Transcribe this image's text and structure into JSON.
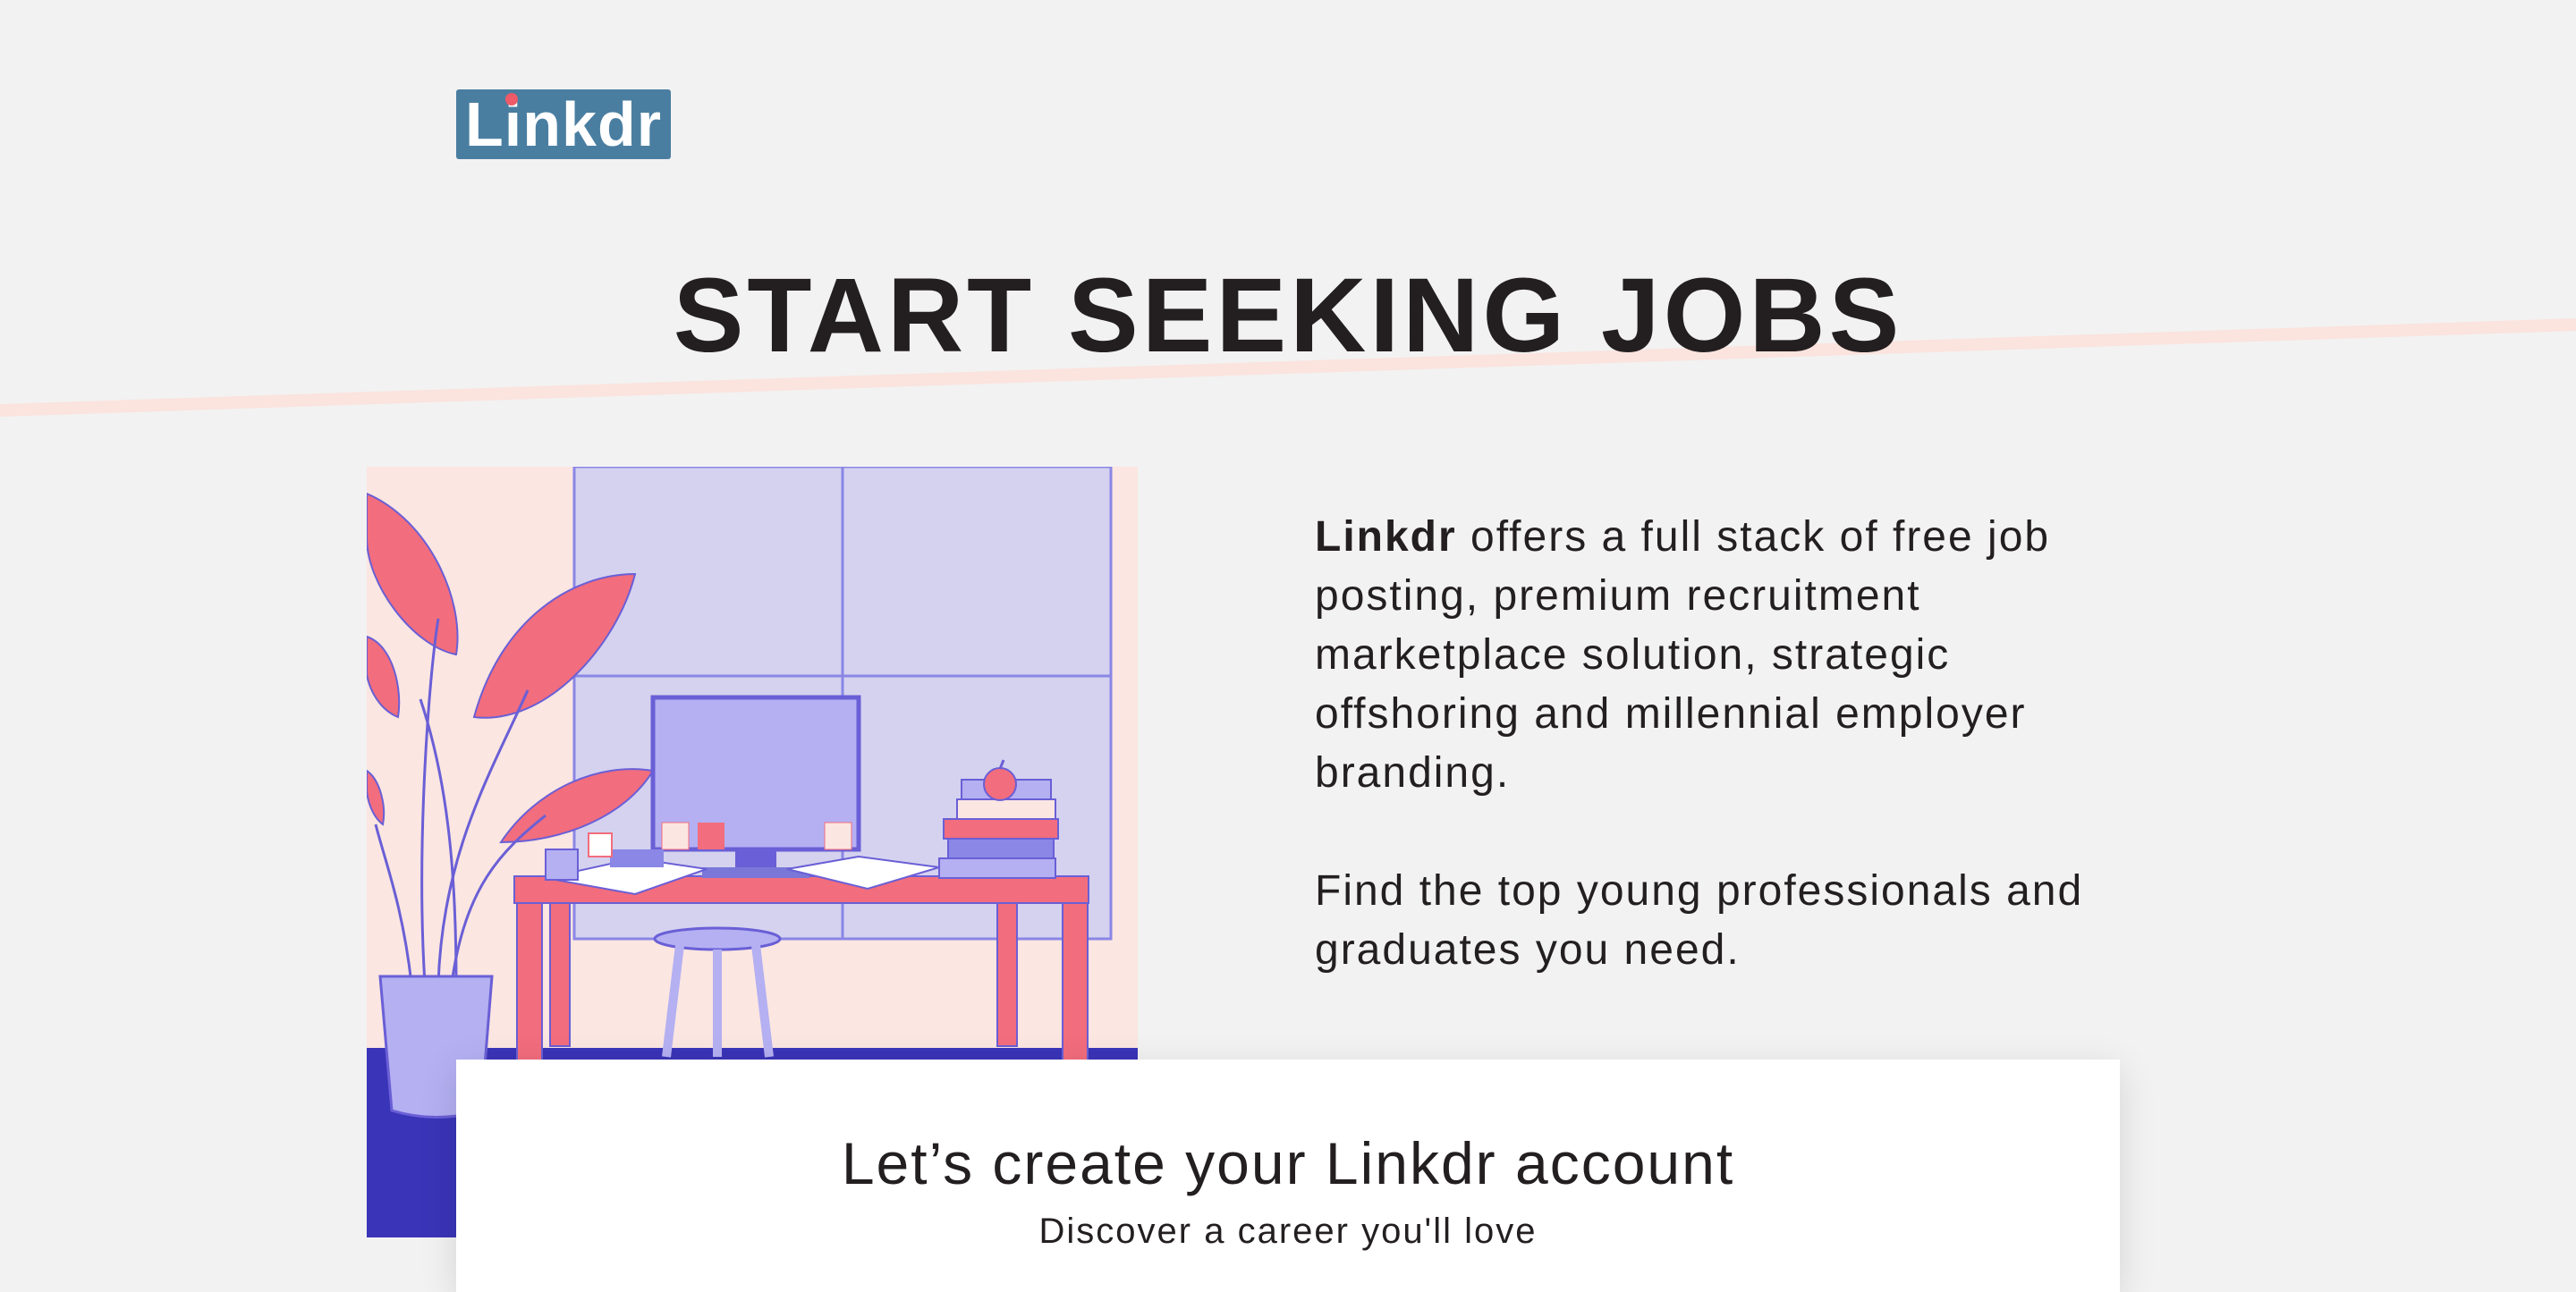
{
  "brand": {
    "logo_text": "Linkdr",
    "logo_color": "#4a7ea1",
    "accent_color": "#ee5a67"
  },
  "hero": {
    "title": "START SEEKING JOBS"
  },
  "description": {
    "brand_name": "Linkdr",
    "paragraph_1_rest": " offers a full stack of free job posting, premium recruitment marketplace solution, strategic offshoring and millennial employer branding.",
    "paragraph_2": "Find the top young professionals and graduates you need."
  },
  "signup_card": {
    "title": "Let’s create your Linkdr account",
    "subtitle": "Discover a career you'll love"
  },
  "illustration": {
    "name": "workspace-illustration"
  }
}
